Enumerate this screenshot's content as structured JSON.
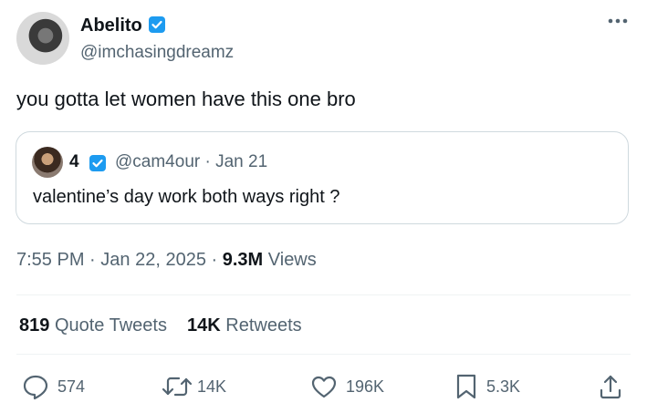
{
  "author": {
    "name": "Abelito",
    "handle": "@imchasingdreamz"
  },
  "tweet": {
    "text": "you gotta let women have this one bro"
  },
  "quote": {
    "name": "4",
    "handle": "@cam4our",
    "separator": "·",
    "date": "Jan 21",
    "text": "valentine’s day work both ways right ?"
  },
  "meta": {
    "time": "7:55 PM",
    "sep1": "·",
    "date": "Jan 22, 2025",
    "sep2": "·",
    "views_count": "9.3M",
    "views_label": "Views"
  },
  "stats": {
    "quote_tweets_count": "819",
    "quote_tweets_label": "Quote Tweets",
    "retweets_count": "14K",
    "retweets_label": "Retweets"
  },
  "actions": {
    "replies": "574",
    "retweets": "14K",
    "likes": "196K",
    "bookmarks": "5.3K"
  },
  "colors": {
    "verified": "#1d9bf0",
    "secondary_text": "#536471",
    "primary_text": "#0f1419",
    "border": "#cfd9de"
  },
  "icons": [
    "verified-badge-icon",
    "more-icon",
    "reply-icon",
    "retweet-icon",
    "like-icon",
    "bookmark-icon",
    "share-icon"
  ]
}
